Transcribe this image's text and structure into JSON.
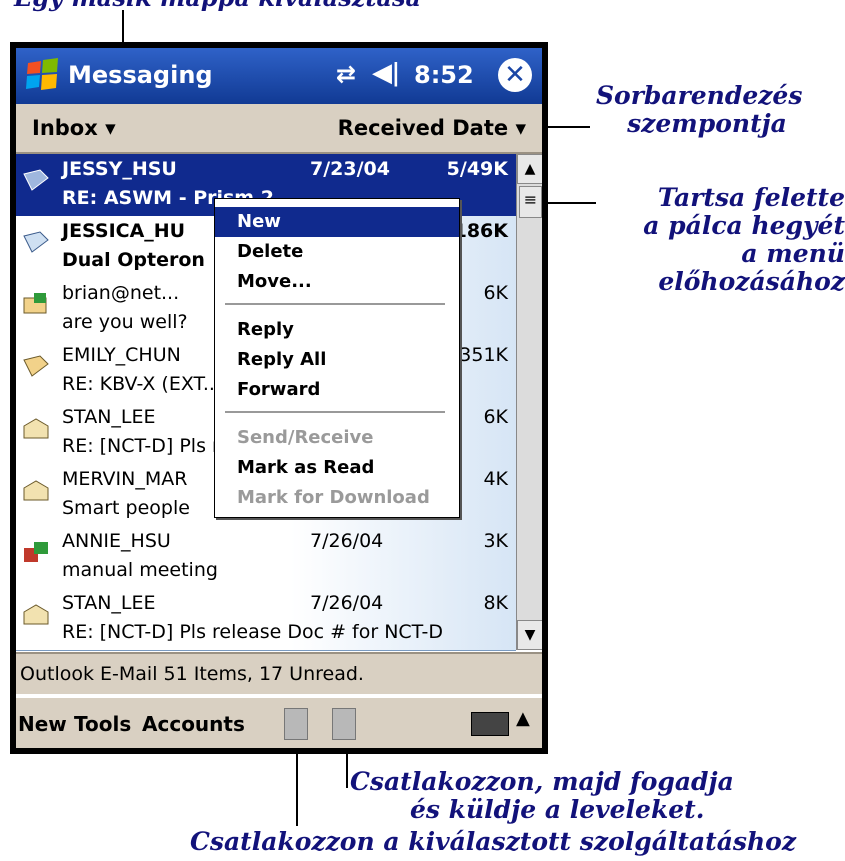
{
  "annotations": {
    "top_partial": "Egy másik mappa kiválasztása",
    "sort_label_1": "Sorbarendezés",
    "sort_label_2": "szempontja",
    "hold_1": "Tartsa felette",
    "hold_2": "a pálca hegyét",
    "hold_3": "a menü előhozásához",
    "send_1": "Csatlakozzon, majd fogadja",
    "send_2": "és küldje a leveleket.",
    "connect": "Csatlakozzon a kiválasztott szolgáltatáshoz"
  },
  "window": {
    "title": "Messaging",
    "time": "8:52",
    "close": "✕",
    "sync_icon": "⇄",
    "volume_icon": "◀ǀ"
  },
  "folder": {
    "name": "Inbox",
    "sort_by": "Received Date"
  },
  "messages": [
    {
      "from": "JESSY_HSU",
      "date": "7/23/04",
      "size": "5/49K",
      "subject": "RE: ASWM - Prism 2",
      "selected": true,
      "bold": true
    },
    {
      "from": "JESSICA_HU",
      "date": "",
      "size": "186K",
      "subject": "Dual Opteron",
      "bold": true
    },
    {
      "from": "brian@net...",
      "date": "",
      "size": "6K",
      "subject": "are you well?"
    },
    {
      "from": "EMILY_CHUN",
      "date": "",
      "size": "351K",
      "subject": "RE: KBV-X (EXT...)"
    },
    {
      "from": "STAN_LEE",
      "date": "",
      "size": "6K",
      "subject": "RE: [NCT-D] Pls release Doc # for NCT-D"
    },
    {
      "from": "MERVIN_MAR",
      "date": "",
      "size": "4K",
      "subject": "Smart people"
    },
    {
      "from": "ANNIE_HSU",
      "date": "7/26/04",
      "size": "3K",
      "subject": "manual meeting"
    },
    {
      "from": "STAN_LEE",
      "date": "7/26/04",
      "size": "8K",
      "subject": "RE: [NCT-D] Pls release Doc # for NCT-D"
    }
  ],
  "context_menu": [
    "New",
    "Delete",
    "Move...",
    "Reply",
    "Reply All",
    "Forward",
    "Send/Receive",
    "Mark as Read",
    "Mark for Download"
  ],
  "status": "Outlook E-Mail  51 Items, 17 Unread.",
  "commands": {
    "new": "New",
    "tools": "Tools",
    "accounts": "Accounts"
  }
}
